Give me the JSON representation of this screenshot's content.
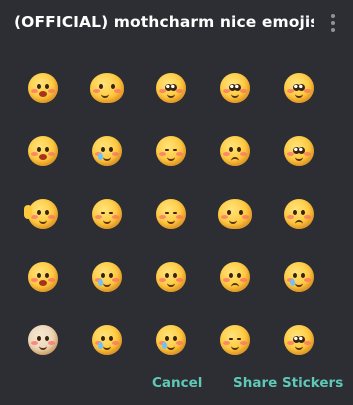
{
  "header": {
    "title": "(OFFICIAL) mothcharm nice emojis s...",
    "menu_icon": "more-vertical-icon"
  },
  "stickers": {
    "rows": 5,
    "columns": 5,
    "icon": "sticker-emoji-icon"
  },
  "footer": {
    "cancel_label": "Cancel",
    "share_label": "Share Stickers"
  },
  "colors": {
    "background": "#2c2e33",
    "accent": "#5fc9b8",
    "title": "#ffffff"
  }
}
